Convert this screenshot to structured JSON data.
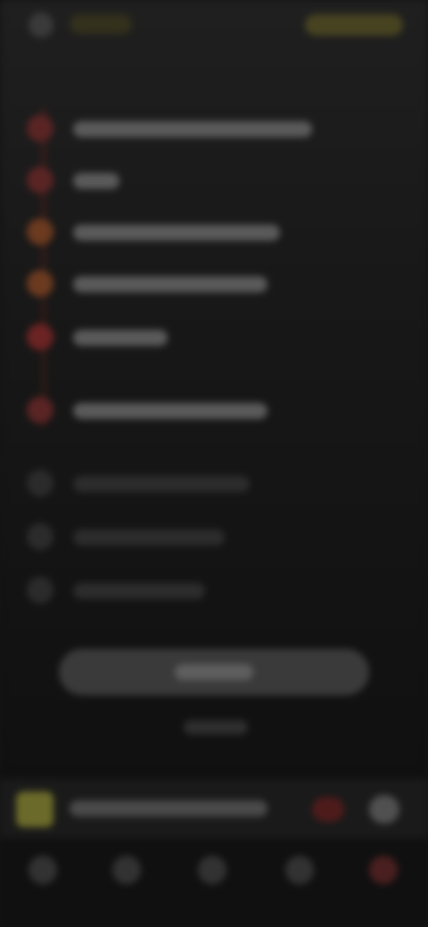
{
  "colors": {
    "background": "#141414",
    "accent_red": "#6b2323",
    "accent_orange": "#6b3a1f",
    "accent_yellow": "#6b6a2a",
    "muted": "#2b2b2b"
  },
  "header": {
    "back_icon": "arrow-left-icon"
  },
  "list": {
    "primary_rows": [
      {
        "icon": "dot-icon",
        "color": "#5a2424",
        "text_width": 268
      },
      {
        "icon": "dot-icon",
        "color": "#5a2424",
        "text_width": 52
      },
      {
        "icon": "dot-icon",
        "color": "#6b3a1f",
        "text_width": 232
      },
      {
        "icon": "dot-icon",
        "color": "#6b3a1f",
        "text_width": 218
      },
      {
        "icon": "dot-icon",
        "color": "#6b2323",
        "text_width": 106
      },
      {
        "icon": "dot-icon",
        "color": "#5a2424",
        "text_width": 218
      }
    ],
    "secondary_rows": [
      {
        "icon": "dot-icon",
        "text_width": 198
      },
      {
        "icon": "dot-icon",
        "text_width": 170
      },
      {
        "icon": "dot-icon",
        "text_width": 148
      }
    ]
  },
  "player": {
    "thumb_icon": "album-art-icon",
    "heart_icon": "heart-icon",
    "play_icon": "play-icon"
  },
  "navbar": {
    "items": [
      {
        "icon": "home-icon"
      },
      {
        "icon": "search-icon"
      },
      {
        "icon": "library-icon"
      },
      {
        "icon": "profile-icon"
      },
      {
        "icon": "premium-icon"
      }
    ]
  }
}
